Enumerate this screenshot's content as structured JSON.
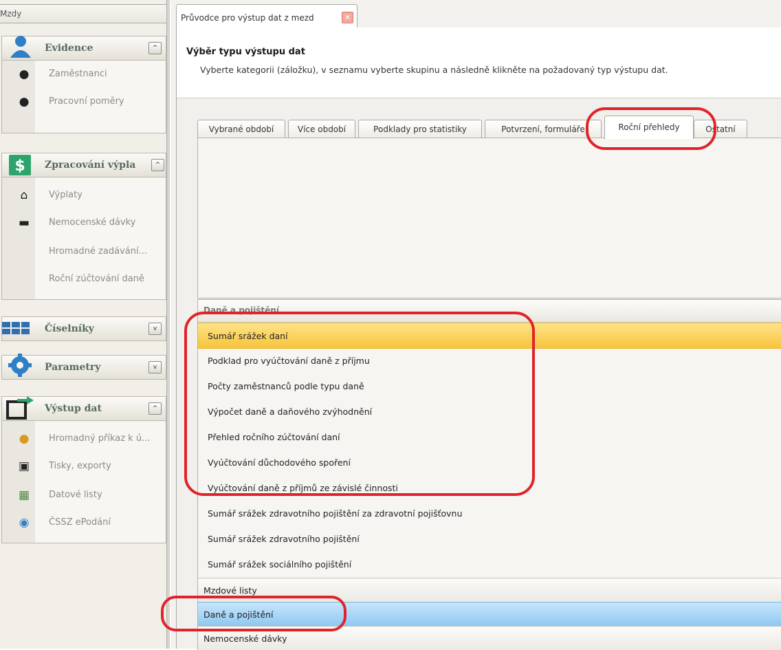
{
  "left_panel": {
    "title": "Mzdy",
    "groups": [
      {
        "label": "Evidence",
        "icon": "user-icon",
        "toggle": "^",
        "items": [
          {
            "label": "Zaměstnanci",
            "icon": "user-icon"
          },
          {
            "label": "Pracovní poměry",
            "icon": "users-icon"
          }
        ]
      },
      {
        "label": "Zpracování výpla",
        "icon": "dollar-icon",
        "toggle": "^",
        "items": [
          {
            "label": "Výplaty",
            "icon": "bank-icon"
          },
          {
            "label": "Nemocenské dávky",
            "icon": "bed-icon"
          },
          {
            "label": "Hromadné zadávání...",
            "icon": ""
          },
          {
            "label": "Roční zúčtování daně",
            "icon": ""
          }
        ]
      },
      {
        "label": "Číselníky",
        "icon": "grid-icon",
        "toggle": "v",
        "items": []
      },
      {
        "label": "Parametry",
        "icon": "gear-icon",
        "toggle": "v",
        "items": []
      },
      {
        "label": "Výstup dat",
        "icon": "export-icon",
        "toggle": "^",
        "items": [
          {
            "label": "Hromadný příkaz k ú...",
            "icon": "coins-icon"
          },
          {
            "label": "Tisky, exporty",
            "icon": "printer-icon"
          },
          {
            "label": "Datové listy",
            "icon": "datasheet-icon"
          },
          {
            "label": "ČSSZ ePodání",
            "icon": "globe-doc-icon"
          }
        ]
      }
    ]
  },
  "document_tab": {
    "label": "Průvodce pro výstup dat z mezd",
    "close": "✕"
  },
  "header": {
    "title": "Výběr typu výstupu dat",
    "description": "Vyberte kategorii (záložku), v seznamu vyberte skupinu a následně klikněte na požadovaný typ výstupu dat."
  },
  "tabs": [
    {
      "label": "Vybrané období"
    },
    {
      "label": "Více období"
    },
    {
      "label": "Podklady pro statistiky"
    },
    {
      "label": "Potvrzení, formuláře"
    },
    {
      "label": "Roční přehledy",
      "active": true
    },
    {
      "label": "Ostatní"
    }
  ],
  "list": {
    "category_header": "Daně a pojištění",
    "items": [
      {
        "label": "Sumář srážek daní",
        "selected": true
      },
      {
        "label": "Podklad pro vyúčtování daně z příjmu"
      },
      {
        "label": "Počty zaměstnanců podle typu daně"
      },
      {
        "label": "Výpočet daně a daňového zvýhodnění"
      },
      {
        "label": "Přehled ročního zúčtování daní"
      },
      {
        "label": "Vyúčtování důchodového spoření"
      },
      {
        "label": "Vyúčtování daně z příjmů ze závislé činnosti"
      },
      {
        "label": "Sumář srážek zdravotního pojištění za zdravotní pojišťovnu"
      },
      {
        "label": "Sumář srážek zdravotního pojištění"
      },
      {
        "label": "Sumář srážek sociálního pojištění"
      }
    ]
  },
  "bottom_groups": [
    {
      "label": "Mzdové listy"
    },
    {
      "label": "Daně a pojištění",
      "active": true
    },
    {
      "label": "Nemocenské dávky"
    }
  ],
  "colors": {
    "selection_yellow": "#f7c43b",
    "active_group_blue": "#8ec8f1",
    "annotation_red": "#e0232b",
    "group_label": "#556b5e"
  }
}
